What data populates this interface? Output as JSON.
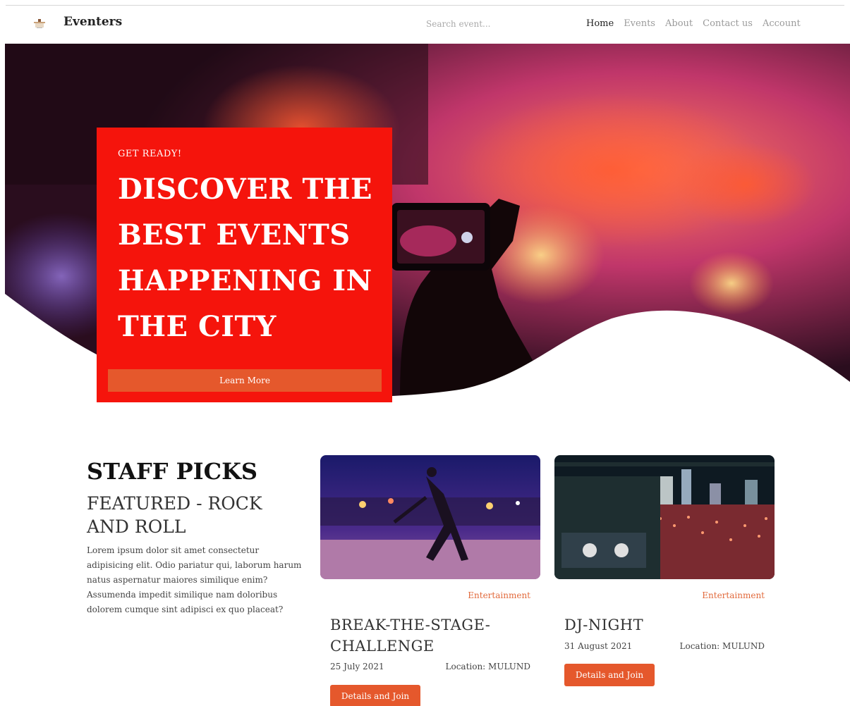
{
  "header": {
    "brand": "Eventers",
    "search_placeholder": "Search event...",
    "nav": [
      "Home",
      "Events",
      "About",
      "Contact us",
      "Account"
    ],
    "active_nav": "Home"
  },
  "hero": {
    "eyebrow": "GET READY!",
    "title_lines": [
      "DISCOVER THE",
      "BEST EVENTS",
      "HAPPENING IN",
      "THE CITY"
    ],
    "button_label": "Learn More",
    "card_color": "#f5140c"
  },
  "staff_picks": {
    "title": "STAFF PICKS",
    "subtitle": "FEATURED - ROCK AND ROLL",
    "description": "Lorem ipsum dolor sit amet consectetur adipisicing elit. Odio pariatur qui, laborum harum natus aspernatur maiores similique enim? Assumenda impedit similique nam doloribus dolorem cumque sint adipisci ex quo placeat?",
    "events": [
      {
        "category": "Entertainment",
        "title": "BREAK-THE-STAGE-CHALLENGE",
        "date": "25 July 2021",
        "location": "Location: MULUND",
        "button_label": "Details and Join"
      },
      {
        "category": "Entertainment",
        "title": "DJ-NIGHT",
        "date": "31 August 2021",
        "location": "Location: MULUND",
        "button_label": "Details and Join"
      }
    ]
  },
  "colors": {
    "accent": "#e5582c",
    "hero_red": "#f5140c",
    "category_text": "#e26a3c"
  }
}
